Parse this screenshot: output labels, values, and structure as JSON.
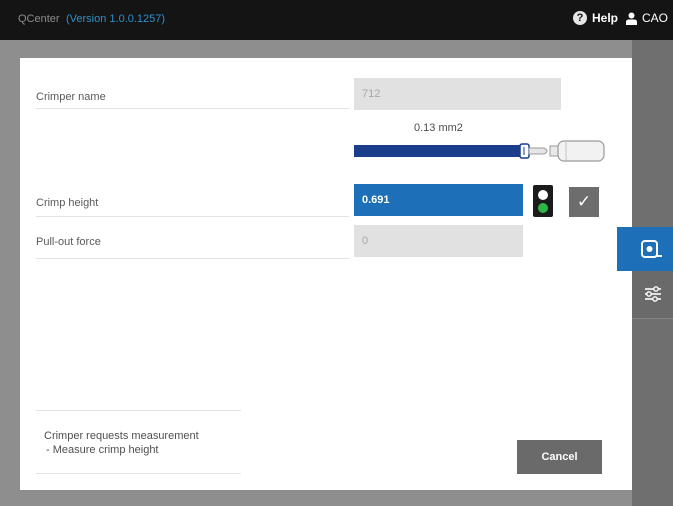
{
  "header": {
    "app_name": "QCenter",
    "version": "(Version 1.0.0.1257)",
    "help_label": "Help",
    "help_icon": "help-circle-icon",
    "user_label": "CAO",
    "user_icon": "user-icon"
  },
  "form": {
    "crimper_name": {
      "label": "Crimper name",
      "value": "712"
    },
    "wire": {
      "cross_section": "0.13 mm2",
      "icon": "crimped-wire-icon"
    },
    "crimp_height": {
      "label": "Crimp height",
      "value": "0.691"
    },
    "pull_out_force": {
      "label": "Pull-out force",
      "value": "0"
    }
  },
  "indicator": {
    "icon": "traffic-light-icon",
    "top_color": "#ffffff",
    "bottom_color": "#2fb44a",
    "confirm_icon": "checkmark-icon"
  },
  "status": {
    "title": "Crimper requests measurement",
    "detail": "- Measure crimp height"
  },
  "buttons": {
    "cancel": "Cancel"
  },
  "side_tabs": [
    {
      "icon": "measurement-icon",
      "active": true
    },
    {
      "icon": "sliders-icon",
      "active": false
    }
  ],
  "colors": {
    "accent": "#1d6fb8",
    "version_text": "#2f8fc9",
    "titlebar": "#141414",
    "frame": "#8e8e8e"
  }
}
